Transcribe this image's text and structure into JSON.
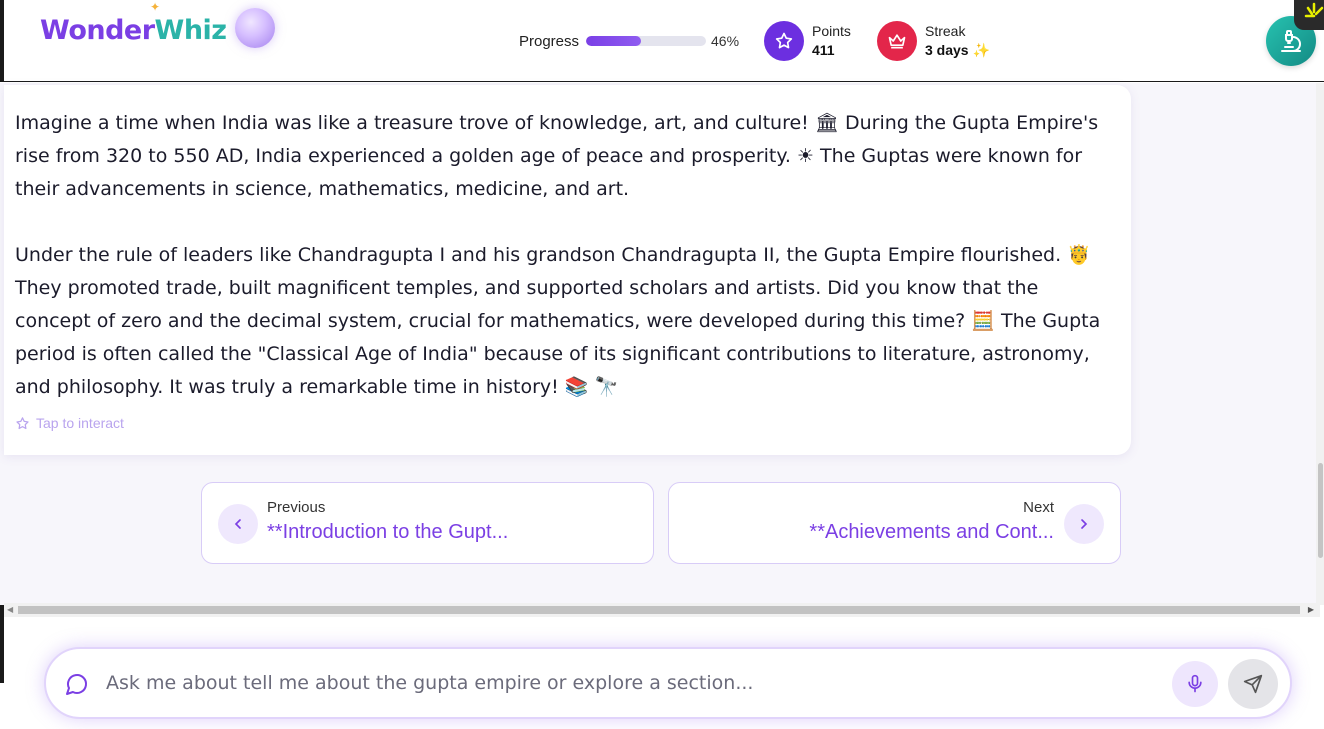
{
  "header": {
    "logo_part1": "Wonder",
    "logo_part2": "Whiz",
    "progress_label": "Progress",
    "progress_value": 0.46,
    "progress_text": "46%",
    "points_label": "Points",
    "points_value": "411",
    "streak_label": "Streak",
    "streak_value": "3 days"
  },
  "content": {
    "paragraph1": "Imagine a time when India was like a treasure trove of knowledge, art, and culture! 🏛 During the Gupta Empire's rise from 320 to 550 AD, India experienced a golden age of peace and prosperity. ☀ The Guptas were known for their advancements in science, mathematics, medicine, and art.",
    "paragraph2": "Under the rule of leaders like Chandragupta I and his grandson Chandragupta II, the Gupta Empire flourished. 🤴 They promoted trade, built magnificent temples, and supported scholars and artists. Did you know that the concept of zero and the decimal system, crucial for mathematics, were developed during this time? 🧮 The Gupta period is often called the \"Classical Age of India\" because of its significant contributions to literature, astronomy, and philosophy. It was truly a remarkable time in history! 📚 🔭",
    "tap_hint": "Tap to interact"
  },
  "navigation": {
    "prev_label": "Previous",
    "prev_title": "**Introduction to the Gupt...",
    "next_label": "Next",
    "next_title": "**Achievements and Cont..."
  },
  "chat": {
    "placeholder": "Ask me about tell me about the gupta empire or explore a section..."
  },
  "colors": {
    "accent": "#7b3fe4",
    "teal": "#2bb3a8",
    "streak_red": "#e3264a"
  }
}
